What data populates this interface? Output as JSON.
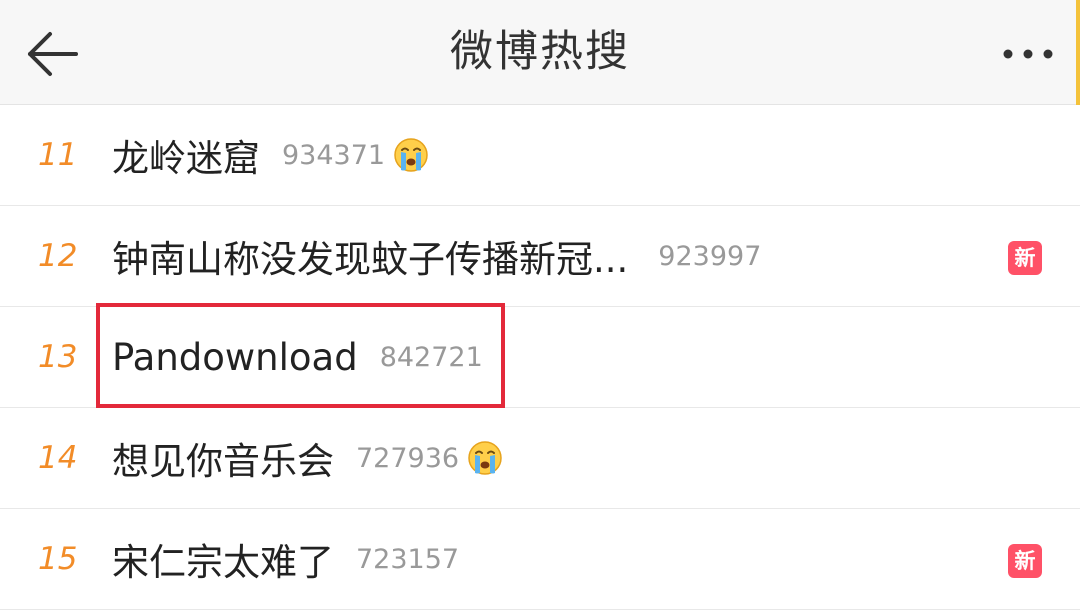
{
  "header": {
    "title": "微博热搜",
    "back_icon": "arrow-left-icon",
    "more_icon": "more-dots-icon"
  },
  "colors": {
    "rank": "#f28c28",
    "badge": "#ff5167",
    "highlight": "#e3293a"
  },
  "hot_list": [
    {
      "rank": "11",
      "topic": "龙岭迷窟",
      "count": "934371",
      "emoji": "crying-face-icon",
      "badge": ""
    },
    {
      "rank": "12",
      "topic": "钟南山称没发现蚊子传播新冠...",
      "count": "923997",
      "emoji": "",
      "badge": "新"
    },
    {
      "rank": "13",
      "topic": "Pandownload",
      "count": "842721",
      "emoji": "",
      "badge": ""
    },
    {
      "rank": "14",
      "topic": "想见你音乐会",
      "count": "727936",
      "emoji": "crying-face-icon",
      "badge": ""
    },
    {
      "rank": "15",
      "topic": "宋仁宗太难了",
      "count": "723157",
      "emoji": "",
      "badge": "新"
    }
  ]
}
